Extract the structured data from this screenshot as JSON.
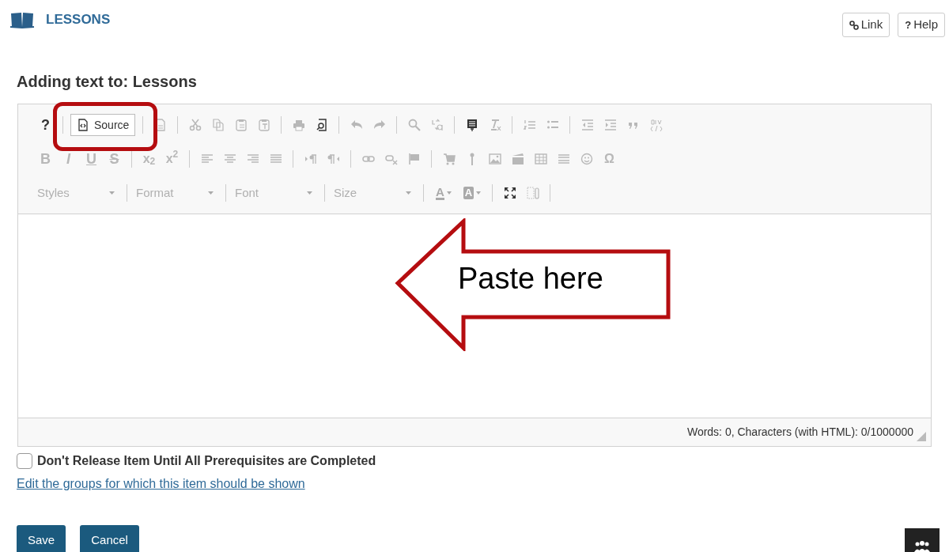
{
  "header": {
    "title": "LESSONS",
    "buttons": [
      {
        "kind": "link",
        "label": "Link"
      },
      {
        "kind": "help",
        "glyph": "?",
        "label": "Help"
      }
    ]
  },
  "heading": "Adding text to: Lessons",
  "toolbar": [
    [
      {
        "kind": "text",
        "label": "?",
        "disabled": false
      },
      {
        "kind": "sep"
      },
      {
        "kind": "button",
        "label": "Source",
        "highlighted": true
      },
      {
        "kind": "sep"
      },
      {
        "kind": "icon",
        "disabled": true
      },
      {
        "kind": "sep"
      },
      {
        "kind": "icon",
        "disabled": true
      },
      {
        "kind": "icon",
        "disabled": true
      },
      {
        "kind": "icon",
        "disabled": true
      },
      {
        "kind": "icon",
        "disabled": true
      },
      {
        "kind": "sep"
      },
      {
        "kind": "icon",
        "disabled": true
      },
      {
        "kind": "icon",
        "disabled": false
      },
      {
        "kind": "sep"
      },
      {
        "kind": "icon",
        "disabled": true
      },
      {
        "kind": "icon",
        "disabled": true
      },
      {
        "kind": "sep"
      },
      {
        "kind": "icon",
        "disabled": true
      },
      {
        "kind": "icon",
        "disabled": true
      },
      {
        "kind": "sep"
      },
      {
        "kind": "icon",
        "disabled": false
      },
      {
        "kind": "icon",
        "disabled": true
      },
      {
        "kind": "sep"
      },
      {
        "kind": "icon",
        "disabled": true
      },
      {
        "kind": "icon",
        "disabled": true
      },
      {
        "kind": "sep"
      },
      {
        "kind": "icon",
        "disabled": true
      },
      {
        "kind": "icon",
        "disabled": true
      },
      {
        "kind": "icon",
        "disabled": true
      },
      {
        "kind": "icon",
        "disabled": true
      }
    ],
    [
      {
        "kind": "text",
        "label": "B",
        "disabled": true
      },
      {
        "kind": "text",
        "label": "I",
        "disabled": true
      },
      {
        "kind": "text",
        "label": "U",
        "disabled": true
      },
      {
        "kind": "text",
        "label": "S",
        "disabled": true
      },
      {
        "kind": "sep"
      },
      {
        "kind": "text",
        "label": "x$_{2}$",
        "disabled": true
      },
      {
        "kind": "text",
        "label": "x$^{2}$",
        "disabled": true
      },
      {
        "kind": "sep"
      },
      {
        "kind": "icon",
        "disabled": true
      },
      {
        "kind": "icon",
        "disabled": true
      },
      {
        "kind": "icon",
        "disabled": true
      },
      {
        "kind": "icon",
        "disabled": true
      },
      {
        "kind": "sep"
      },
      {
        "kind": "icon",
        "disabled": true
      },
      {
        "kind": "icon",
        "disabled": true
      },
      {
        "kind": "sep"
      },
      {
        "kind": "icon",
        "disabled": true
      },
      {
        "kind": "icon",
        "disabled": true
      },
      {
        "kind": "icon",
        "disabled": true
      },
      {
        "kind": "sep"
      },
      {
        "kind": "icon",
        "disabled": true
      },
      {
        "kind": "icon",
        "disabled": true
      },
      {
        "kind": "icon",
        "disabled": true
      },
      {
        "kind": "icon",
        "disabled": true
      },
      {
        "kind": "icon",
        "disabled": true
      },
      {
        "kind": "icon",
        "disabled": true
      },
      {
        "kind": "icon",
        "disabled": true
      },
      {
        "kind": "text",
        "label": "Ω",
        "disabled": true
      }
    ],
    [
      {
        "kind": "combo",
        "label": "Styles"
      },
      {
        "kind": "sep"
      },
      {
        "kind": "combo",
        "label": "Format"
      },
      {
        "kind": "sep"
      },
      {
        "kind": "combo",
        "label": "Font"
      },
      {
        "kind": "sep"
      },
      {
        "kind": "combo",
        "label": "Size"
      },
      {
        "kind": "sep"
      },
      {
        "kind": "color",
        "label": "A"
      },
      {
        "kind": "color",
        "label": "A"
      },
      {
        "kind": "sep"
      },
      {
        "kind": "icon",
        "disabled": false
      },
      {
        "kind": "icon",
        "disabled": true
      },
      {
        "kind": "sep"
      }
    ]
  ],
  "callout": "Paste here",
  "status": "Words: 0, Characters (with HTML): 0/1000000",
  "checkbox": {
    "label": "Don't Release Item Until All Prerequisites are Completed",
    "checked": false
  },
  "groups_link": "Edit the groups for which this item should be shown",
  "actions": [
    "Save",
    "Cancel"
  ]
}
